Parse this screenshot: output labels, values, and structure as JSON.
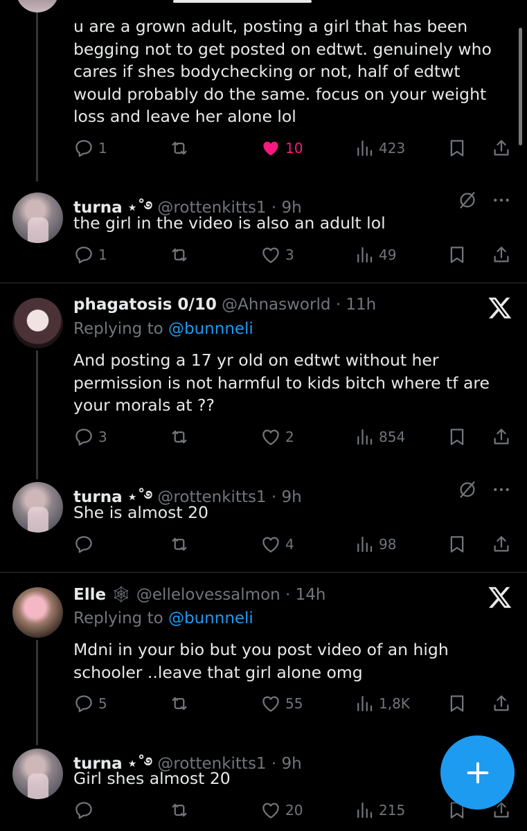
{
  "colors": {
    "accent": "#1d9bf0",
    "like": "#f91880",
    "muted": "#71767b",
    "text": "#e7e9ea"
  },
  "tweets": [
    {
      "body": "u are a grown adult, posting a girl that has been begging not to get posted on edtwt. genuinely who cares if shes bodychecking or not, half of edtwt would probably do the same. focus on your weight loss and leave her alone lol",
      "replies": "1",
      "retweets": "",
      "likes": "10",
      "liked": true,
      "views": "423"
    },
    {
      "name": "turna",
      "name_symbols": "⋆˚࿔",
      "handle": "@rottenkitts1",
      "time": "· 9h",
      "body": "the girl in the video is also an adult lol",
      "replies": "1",
      "retweets": "",
      "likes": "3",
      "views": "49"
    },
    {
      "name": "phagatosis 0/10",
      "handle": "@Ahnasworld",
      "time": "· 11h",
      "replying_prefix": "Replying to ",
      "replying_to": "@bunnneli",
      "body": "And posting a 17 yr old on edtwt without her permission is not harmful to kids bitch where tf are your morals at ??",
      "replies": "3",
      "retweets": "",
      "likes": "2",
      "views": "854"
    },
    {
      "name": "turna",
      "name_symbols": "⋆˚࿔",
      "handle": "@rottenkitts1",
      "time": "· 9h",
      "body": "She is almost 20",
      "replies": "",
      "retweets": "",
      "likes": "4",
      "views": "98"
    },
    {
      "name": "Elle",
      "name_symbols": "🕸",
      "handle": "@ellelovessalmon",
      "time": "· 14h",
      "replying_prefix": "Replying to ",
      "replying_to": "@bunnneli",
      "body": "Mdni in your bio but you post video of an high schooler ..leave that girl alone omg",
      "replies": "5",
      "retweets": "",
      "likes": "55",
      "views": "1,8K"
    },
    {
      "name": "turna",
      "name_symbols": "⋆˚࿔",
      "handle": "@rottenkitts1",
      "time": "· 9h",
      "body": "Girl shes almost 20",
      "replies": "",
      "retweets": "",
      "likes": "20",
      "views": "215"
    }
  ],
  "icons": {
    "reply": "reply-icon",
    "retweet": "retweet-icon",
    "like": "heart-icon",
    "views": "views-icon",
    "bookmark": "bookmark-icon",
    "share": "share-icon",
    "x_logo": "x-logo-icon",
    "mute": "mute-icon",
    "more": "more-icon",
    "compose": "plus-icon"
  }
}
